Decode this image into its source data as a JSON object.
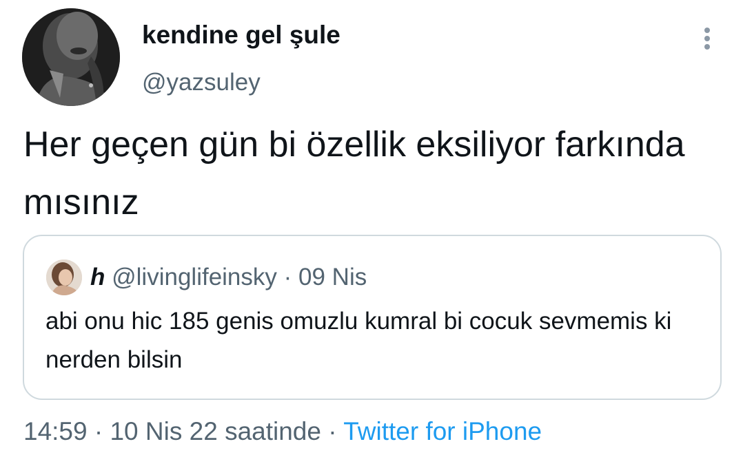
{
  "author": {
    "display_name": "kendine gel şule",
    "handle": "@yazsuley"
  },
  "tweet": {
    "text": "Her geçen gün bi özellik eksiliyor farkında mısınız"
  },
  "quote": {
    "name": "h",
    "handle": "@livinglifeinsky",
    "separator": "·",
    "date": "09 Nis",
    "text": "abi onu hic 185 genis omuzlu kumral bi cocuk sevmemis ki nerden bilsin"
  },
  "meta": {
    "time": "14:59",
    "sep1": "·",
    "date": "10 Nis 22 saatinde",
    "sep2": "·",
    "source": "Twitter for iPhone"
  },
  "icons": {
    "more": "more-vertical-icon"
  },
  "colors": {
    "primary_text": "#0f1419",
    "secondary_text": "#536471",
    "link": "#1d9bf0",
    "border": "#cfd9de"
  }
}
